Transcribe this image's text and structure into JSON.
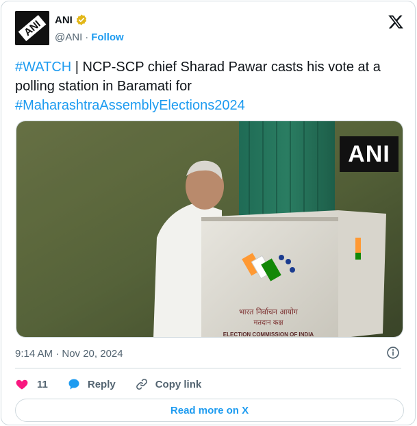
{
  "author": {
    "name": "ANI",
    "handle": "@ANI",
    "separator": "·",
    "follow_label": "Follow",
    "avatar_text": "ANI"
  },
  "tweet": {
    "hashtag_watch": "#WATCH",
    "body": " | NCP-SCP chief Sharad Pawar casts his vote at a polling station in Baramati for ",
    "hashtag_election": "#MaharashtraAssemblyElections2024"
  },
  "media": {
    "watermark": "ANI",
    "booth_text_line1": "भारत निर्वाचन आयोग",
    "booth_text_line2": "मतदान कक्ष",
    "booth_text_line3": "ELECTION COMMISSION OF INDIA"
  },
  "timestamp": "9:14 AM · Nov 20, 2024",
  "actions": {
    "like_count": "11",
    "reply_label": "Reply",
    "copy_link_label": "Copy link"
  },
  "read_more_label": "Read more on X",
  "colors": {
    "accent": "#1d9bf0",
    "like": "#f91880",
    "verified": "#e2b719",
    "muted": "#536471"
  },
  "icons": [
    "x-logo-icon",
    "verified-badge-icon",
    "info-icon",
    "heart-icon",
    "reply-bubble-icon",
    "link-icon"
  ]
}
